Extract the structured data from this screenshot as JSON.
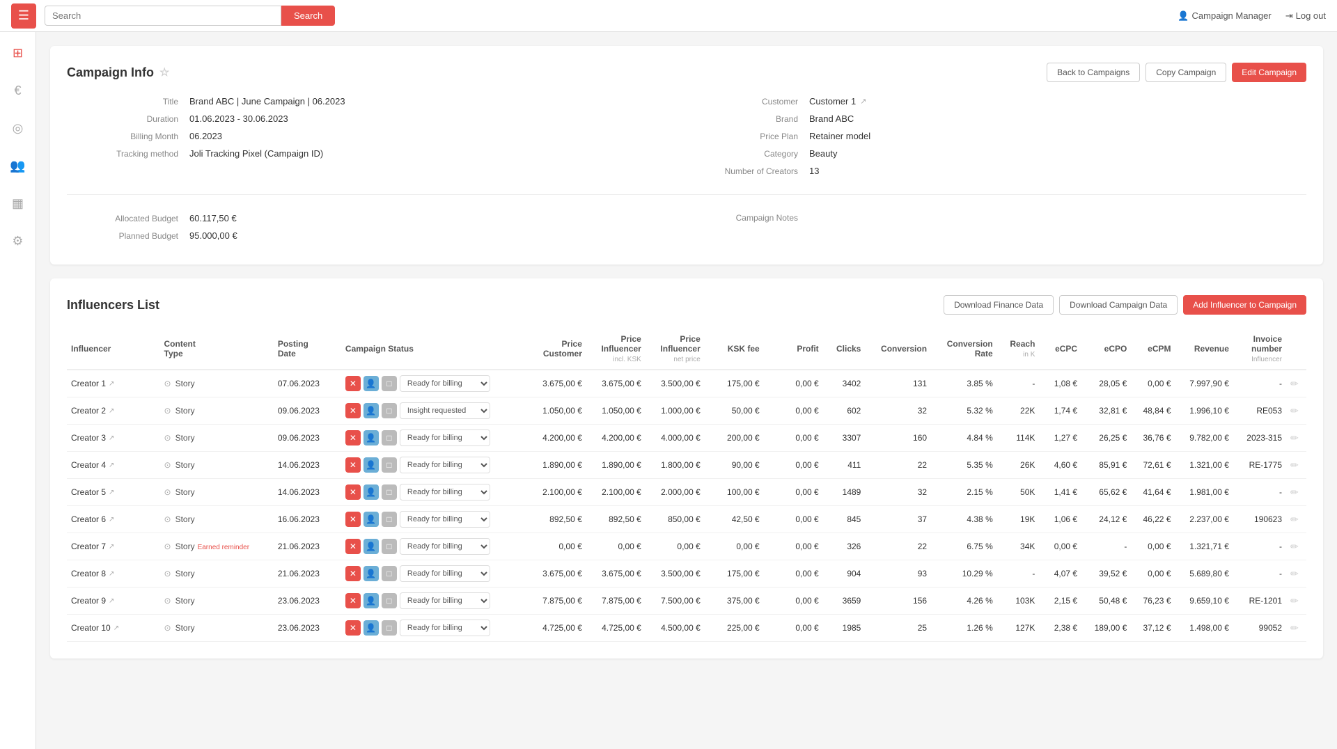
{
  "app": {
    "hamburger_label": "☰",
    "search_placeholder": "Search",
    "search_btn": "Search",
    "nav_manager": "Campaign Manager",
    "nav_logout": "Log out"
  },
  "sidebar": {
    "icons": [
      {
        "name": "grid-icon",
        "symbol": "⊞"
      },
      {
        "name": "euro-icon",
        "symbol": "€"
      },
      {
        "name": "instagram-icon",
        "symbol": "📷"
      },
      {
        "name": "users-icon",
        "symbol": "👥"
      },
      {
        "name": "calendar-icon",
        "symbol": "📅"
      },
      {
        "name": "settings-icon",
        "symbol": "⚙"
      }
    ]
  },
  "campaign_info": {
    "section_title": "Campaign Info",
    "back_btn": "Back to Campaigns",
    "copy_btn": "Copy Campaign",
    "edit_btn": "Edit Campaign",
    "fields": {
      "title_label": "Title",
      "title_value": "Brand ABC | June Campaign | 06.2023",
      "duration_label": "Duration",
      "duration_value": "01.06.2023 - 30.06.2023",
      "billing_month_label": "Billing Month",
      "billing_month_value": "06.2023",
      "tracking_label": "Tracking method",
      "tracking_value": "Joli Tracking Pixel (Campaign ID)",
      "customer_label": "Customer",
      "customer_value": "Customer 1",
      "brand_label": "Brand",
      "brand_value": "Brand ABC",
      "price_plan_label": "Price Plan",
      "price_plan_value": "Retainer model",
      "category_label": "Category",
      "category_value": "Beauty",
      "num_creators_label": "Number of Creators",
      "num_creators_value": "13"
    },
    "budget": {
      "allocated_label": "Allocated Budget",
      "allocated_value": "60.117,50 €",
      "planned_label": "Planned Budget",
      "planned_value": "95.000,00 €",
      "notes_label": "Campaign Notes"
    }
  },
  "influencers": {
    "section_title": "Influencers List",
    "download_finance_btn": "Download Finance Data",
    "download_campaign_btn": "Download Campaign Data",
    "add_influencer_btn": "Add Influencer to Campaign",
    "columns": {
      "influencer": "Influencer",
      "content_type": "Content Type",
      "posting_date": "Posting Date",
      "campaign_status": "Campaign Status",
      "price_customer": "Price Customer",
      "price_influencer": "Price Influencer",
      "price_influencer_sub": "incl. KSK",
      "price_influencer_net": "Price Influencer",
      "price_influencer_net_sub": "net price",
      "ksk_fee": "KSK fee",
      "profit": "Profit",
      "clicks": "Clicks",
      "conversion": "Conversion",
      "conversion_rate": "Conversion Rate",
      "reach": "Reach",
      "reach_sub": "in K",
      "ecpc": "eCPC",
      "ecpo": "eCPO",
      "ecpm": "eCPM",
      "revenue": "Revenue",
      "invoice_number": "Invoice number",
      "invoice_sub": "Influencer"
    },
    "rows": [
      {
        "id": 1,
        "name": "Creator 1",
        "content_type": "Story",
        "posting_date": "07.06.2023",
        "status": "Ready for billing",
        "price_customer": "3.675,00 €",
        "price_influencer": "3.675,00 €",
        "price_influencer_net": "3.500,00 €",
        "ksk_fee": "175,00 €",
        "profit": "0,00 €",
        "clicks": "3402",
        "conversion": "131",
        "conversion_rate": "3.85 %",
        "reach": "-",
        "ecpc": "1,08 €",
        "ecpo": "28,05 €",
        "ecpm": "0,00 €",
        "revenue": "7.997,90 €",
        "invoice_number": "-",
        "sub_note": ""
      },
      {
        "id": 2,
        "name": "Creator 2",
        "content_type": "Story",
        "posting_date": "09.06.2023",
        "status": "Insight requested",
        "price_customer": "1.050,00 €",
        "price_influencer": "1.050,00 €",
        "price_influencer_net": "1.000,00 €",
        "ksk_fee": "50,00 €",
        "profit": "0,00 €",
        "clicks": "602",
        "conversion": "32",
        "conversion_rate": "5.32 %",
        "reach": "22K",
        "ecpc": "1,74 €",
        "ecpo": "32,81 €",
        "ecpm": "48,84 €",
        "revenue": "1.996,10 €",
        "invoice_number": "RE053",
        "sub_note": ""
      },
      {
        "id": 3,
        "name": "Creator 3",
        "content_type": "Story",
        "posting_date": "09.06.2023",
        "status": "Ready for billing",
        "price_customer": "4.200,00 €",
        "price_influencer": "4.200,00 €",
        "price_influencer_net": "4.000,00 €",
        "ksk_fee": "200,00 €",
        "profit": "0,00 €",
        "clicks": "3307",
        "conversion": "160",
        "conversion_rate": "4.84 %",
        "reach": "114K",
        "ecpc": "1,27 €",
        "ecpo": "26,25 €",
        "ecpm": "36,76 €",
        "revenue": "9.782,00 €",
        "invoice_number": "2023-315",
        "sub_note": ""
      },
      {
        "id": 4,
        "name": "Creator 4",
        "content_type": "Story",
        "posting_date": "14.06.2023",
        "status": "Ready for billing",
        "price_customer": "1.890,00 €",
        "price_influencer": "1.890,00 €",
        "price_influencer_net": "1.800,00 €",
        "ksk_fee": "90,00 €",
        "profit": "0,00 €",
        "clicks": "411",
        "conversion": "22",
        "conversion_rate": "5.35 %",
        "reach": "26K",
        "ecpc": "4,60 €",
        "ecpo": "85,91 €",
        "ecpm": "72,61 €",
        "revenue": "1.321,00 €",
        "invoice_number": "RE-1775",
        "sub_note": ""
      },
      {
        "id": 5,
        "name": "Creator 5",
        "content_type": "Story",
        "posting_date": "14.06.2023",
        "status": "Ready for billing",
        "price_customer": "2.100,00 €",
        "price_influencer": "2.100,00 €",
        "price_influencer_net": "2.000,00 €",
        "ksk_fee": "100,00 €",
        "profit": "0,00 €",
        "clicks": "1489",
        "conversion": "32",
        "conversion_rate": "2.15 %",
        "reach": "50K",
        "ecpc": "1,41 €",
        "ecpo": "65,62 €",
        "ecpm": "41,64 €",
        "revenue": "1.981,00 €",
        "invoice_number": "-",
        "sub_note": ""
      },
      {
        "id": 6,
        "name": "Creator 6",
        "content_type": "Story",
        "posting_date": "16.06.2023",
        "status": "Ready for billing",
        "price_customer": "892,50 €",
        "price_influencer": "892,50 €",
        "price_influencer_net": "850,00 €",
        "ksk_fee": "42,50 €",
        "profit": "0,00 €",
        "clicks": "845",
        "conversion": "37",
        "conversion_rate": "4.38 %",
        "reach": "19K",
        "ecpc": "1,06 €",
        "ecpo": "24,12 €",
        "ecpm": "46,22 €",
        "revenue": "2.237,00 €",
        "invoice_number": "190623",
        "sub_note": ""
      },
      {
        "id": 7,
        "name": "Creator 7",
        "content_type": "Story",
        "posting_date": "21.06.2023",
        "status": "Ready for billing",
        "price_customer": "0,00 €",
        "price_influencer": "0,00 €",
        "price_influencer_net": "0,00 €",
        "ksk_fee": "0,00 €",
        "profit": "0,00 €",
        "clicks": "326",
        "conversion": "22",
        "conversion_rate": "6.75 %",
        "reach": "34K",
        "ecpc": "0,00 €",
        "ecpo": "-",
        "ecpm": "0,00 €",
        "revenue": "1.321,71 €",
        "invoice_number": "-",
        "sub_note": "Earned reminder"
      },
      {
        "id": 8,
        "name": "Creator 8",
        "content_type": "Story",
        "posting_date": "21.06.2023",
        "status": "Ready for billing",
        "price_customer": "3.675,00 €",
        "price_influencer": "3.675,00 €",
        "price_influencer_net": "3.500,00 €",
        "ksk_fee": "175,00 €",
        "profit": "0,00 €",
        "clicks": "904",
        "conversion": "93",
        "conversion_rate": "10.29 %",
        "reach": "-",
        "ecpc": "4,07 €",
        "ecpo": "39,52 €",
        "ecpm": "0,00 €",
        "revenue": "5.689,80 €",
        "invoice_number": "-",
        "sub_note": ""
      },
      {
        "id": 9,
        "name": "Creator 9",
        "content_type": "Story",
        "posting_date": "23.06.2023",
        "status": "Ready for billing",
        "price_customer": "7.875,00 €",
        "price_influencer": "7.875,00 €",
        "price_influencer_net": "7.500,00 €",
        "ksk_fee": "375,00 €",
        "profit": "0,00 €",
        "clicks": "3659",
        "conversion": "156",
        "conversion_rate": "4.26 %",
        "reach": "103K",
        "ecpc": "2,15 €",
        "ecpo": "50,48 €",
        "ecpm": "76,23 €",
        "revenue": "9.659,10 €",
        "invoice_number": "RE-1201",
        "sub_note": ""
      },
      {
        "id": 10,
        "name": "Creator 10",
        "content_type": "Story",
        "posting_date": "23.06.2023",
        "status": "Ready for billing",
        "price_customer": "4.725,00 €",
        "price_influencer": "4.725,00 €",
        "price_influencer_net": "4.500,00 €",
        "ksk_fee": "225,00 €",
        "profit": "0,00 €",
        "clicks": "1985",
        "conversion": "25",
        "conversion_rate": "1.26 %",
        "reach": "127K",
        "ecpc": "2,38 €",
        "ecpo": "189,00 €",
        "ecpm": "37,12 €",
        "revenue": "1.498,00 €",
        "invoice_number": "99052",
        "sub_note": ""
      }
    ]
  }
}
